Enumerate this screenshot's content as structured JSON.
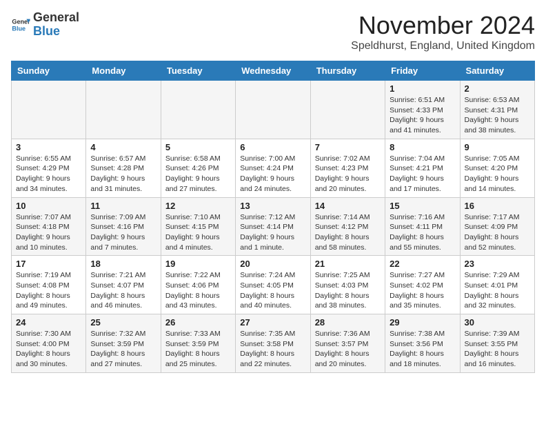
{
  "logo": {
    "general": "General",
    "blue": "Blue"
  },
  "title": "November 2024",
  "location": "Speldhurst, England, United Kingdom",
  "weekdays": [
    "Sunday",
    "Monday",
    "Tuesday",
    "Wednesday",
    "Thursday",
    "Friday",
    "Saturday"
  ],
  "weeks": [
    [
      {
        "day": "",
        "info": ""
      },
      {
        "day": "",
        "info": ""
      },
      {
        "day": "",
        "info": ""
      },
      {
        "day": "",
        "info": ""
      },
      {
        "day": "",
        "info": ""
      },
      {
        "day": "1",
        "info": "Sunrise: 6:51 AM\nSunset: 4:33 PM\nDaylight: 9 hours\nand 41 minutes."
      },
      {
        "day": "2",
        "info": "Sunrise: 6:53 AM\nSunset: 4:31 PM\nDaylight: 9 hours\nand 38 minutes."
      }
    ],
    [
      {
        "day": "3",
        "info": "Sunrise: 6:55 AM\nSunset: 4:29 PM\nDaylight: 9 hours\nand 34 minutes."
      },
      {
        "day": "4",
        "info": "Sunrise: 6:57 AM\nSunset: 4:28 PM\nDaylight: 9 hours\nand 31 minutes."
      },
      {
        "day": "5",
        "info": "Sunrise: 6:58 AM\nSunset: 4:26 PM\nDaylight: 9 hours\nand 27 minutes."
      },
      {
        "day": "6",
        "info": "Sunrise: 7:00 AM\nSunset: 4:24 PM\nDaylight: 9 hours\nand 24 minutes."
      },
      {
        "day": "7",
        "info": "Sunrise: 7:02 AM\nSunset: 4:23 PM\nDaylight: 9 hours\nand 20 minutes."
      },
      {
        "day": "8",
        "info": "Sunrise: 7:04 AM\nSunset: 4:21 PM\nDaylight: 9 hours\nand 17 minutes."
      },
      {
        "day": "9",
        "info": "Sunrise: 7:05 AM\nSunset: 4:20 PM\nDaylight: 9 hours\nand 14 minutes."
      }
    ],
    [
      {
        "day": "10",
        "info": "Sunrise: 7:07 AM\nSunset: 4:18 PM\nDaylight: 9 hours\nand 10 minutes."
      },
      {
        "day": "11",
        "info": "Sunrise: 7:09 AM\nSunset: 4:16 PM\nDaylight: 9 hours\nand 7 minutes."
      },
      {
        "day": "12",
        "info": "Sunrise: 7:10 AM\nSunset: 4:15 PM\nDaylight: 9 hours\nand 4 minutes."
      },
      {
        "day": "13",
        "info": "Sunrise: 7:12 AM\nSunset: 4:14 PM\nDaylight: 9 hours\nand 1 minute."
      },
      {
        "day": "14",
        "info": "Sunrise: 7:14 AM\nSunset: 4:12 PM\nDaylight: 8 hours\nand 58 minutes."
      },
      {
        "day": "15",
        "info": "Sunrise: 7:16 AM\nSunset: 4:11 PM\nDaylight: 8 hours\nand 55 minutes."
      },
      {
        "day": "16",
        "info": "Sunrise: 7:17 AM\nSunset: 4:09 PM\nDaylight: 8 hours\nand 52 minutes."
      }
    ],
    [
      {
        "day": "17",
        "info": "Sunrise: 7:19 AM\nSunset: 4:08 PM\nDaylight: 8 hours\nand 49 minutes."
      },
      {
        "day": "18",
        "info": "Sunrise: 7:21 AM\nSunset: 4:07 PM\nDaylight: 8 hours\nand 46 minutes."
      },
      {
        "day": "19",
        "info": "Sunrise: 7:22 AM\nSunset: 4:06 PM\nDaylight: 8 hours\nand 43 minutes."
      },
      {
        "day": "20",
        "info": "Sunrise: 7:24 AM\nSunset: 4:05 PM\nDaylight: 8 hours\nand 40 minutes."
      },
      {
        "day": "21",
        "info": "Sunrise: 7:25 AM\nSunset: 4:03 PM\nDaylight: 8 hours\nand 38 minutes."
      },
      {
        "day": "22",
        "info": "Sunrise: 7:27 AM\nSunset: 4:02 PM\nDaylight: 8 hours\nand 35 minutes."
      },
      {
        "day": "23",
        "info": "Sunrise: 7:29 AM\nSunset: 4:01 PM\nDaylight: 8 hours\nand 32 minutes."
      }
    ],
    [
      {
        "day": "24",
        "info": "Sunrise: 7:30 AM\nSunset: 4:00 PM\nDaylight: 8 hours\nand 30 minutes."
      },
      {
        "day": "25",
        "info": "Sunrise: 7:32 AM\nSunset: 3:59 PM\nDaylight: 8 hours\nand 27 minutes."
      },
      {
        "day": "26",
        "info": "Sunrise: 7:33 AM\nSunset: 3:59 PM\nDaylight: 8 hours\nand 25 minutes."
      },
      {
        "day": "27",
        "info": "Sunrise: 7:35 AM\nSunset: 3:58 PM\nDaylight: 8 hours\nand 22 minutes."
      },
      {
        "day": "28",
        "info": "Sunrise: 7:36 AM\nSunset: 3:57 PM\nDaylight: 8 hours\nand 20 minutes."
      },
      {
        "day": "29",
        "info": "Sunrise: 7:38 AM\nSunset: 3:56 PM\nDaylight: 8 hours\nand 18 minutes."
      },
      {
        "day": "30",
        "info": "Sunrise: 7:39 AM\nSunset: 3:55 PM\nDaylight: 8 hours\nand 16 minutes."
      }
    ]
  ]
}
